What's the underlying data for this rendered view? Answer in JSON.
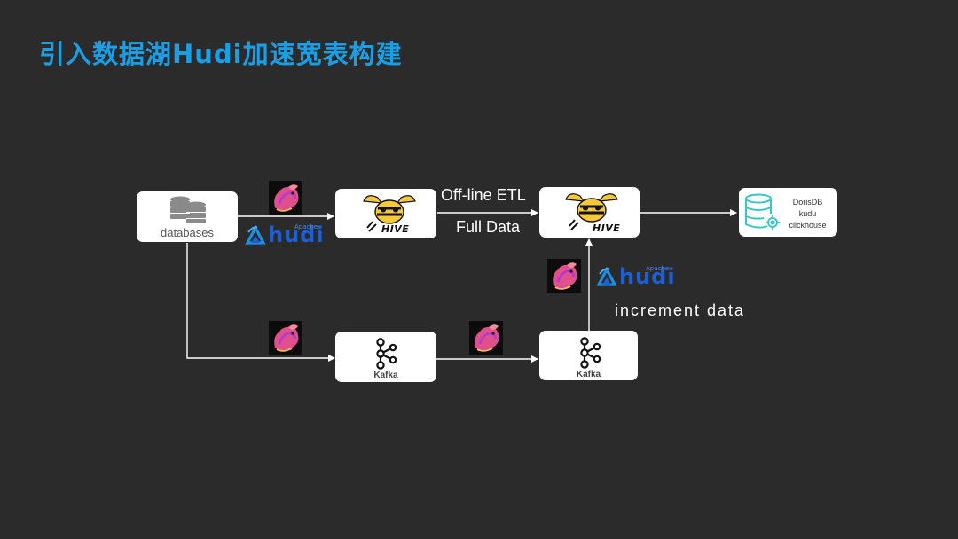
{
  "title": "引入数据湖Hudi加速宽表构建",
  "nodes": {
    "databases": {
      "label": "databases",
      "icon": "database-stack-icon"
    },
    "hive1": {
      "label": "HIVE",
      "icon": "hive-bee-icon"
    },
    "hive2": {
      "label": "HIVE",
      "icon": "hive-bee-icon"
    },
    "olap": {
      "lines": [
        "DorisDB",
        "kudu",
        "clickhouse"
      ],
      "icon": "database-gear-icon"
    },
    "kafka1": {
      "label": "Kafka",
      "icon": "kafka-icon"
    },
    "kafka2": {
      "label": "Kafka",
      "icon": "kafka-icon"
    }
  },
  "edge_labels": {
    "etl": "Off-line ETL",
    "full_data": "Full Data",
    "increment": "increment data"
  },
  "logos": {
    "hudi_word": "hudi",
    "hudi_apache": "Apache",
    "flink_icon": "flink-squirrel-icon"
  },
  "colors": {
    "background": "#2b2b2b",
    "title": "#1a9fe6",
    "hudi": "#1d5fd4",
    "olap_accent": "#3cc7c0"
  }
}
